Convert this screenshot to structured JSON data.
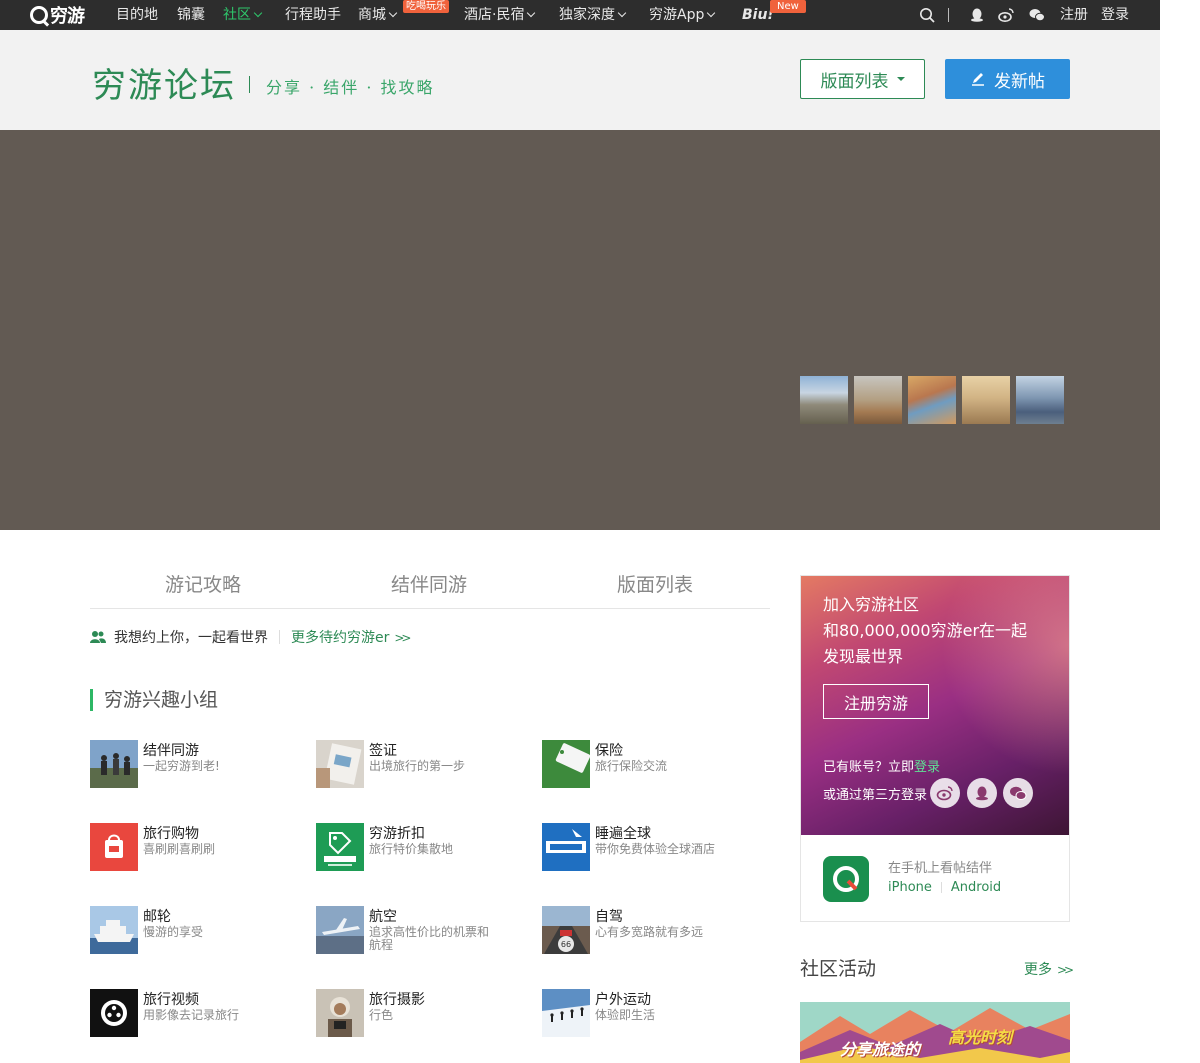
{
  "nav": {
    "logo": "穷游",
    "items": [
      {
        "label": "目的地"
      },
      {
        "label": "锦囊"
      },
      {
        "label": "社区"
      },
      {
        "label": "行程助手"
      },
      {
        "label": "商城",
        "badge": "吃喝玩乐"
      },
      {
        "label": "酒店·民宿"
      },
      {
        "label": "独家深度"
      },
      {
        "label": "穷游App"
      },
      {
        "label": "Biu!",
        "badge": "New"
      }
    ],
    "register": "注册",
    "login": "登录"
  },
  "header": {
    "title": "穷游论坛",
    "slogan": "分享 · 结伴 · 找攻略",
    "board_button": "版面列表",
    "post_button": "发新帖"
  },
  "tabs": [
    "游记攻略",
    "结伴同游",
    "版面列表"
  ],
  "invite": {
    "text": "我想约上你，一起看世界",
    "more": "更多待约穷游er"
  },
  "groups": {
    "title": "穷游兴趣小组",
    "items": [
      {
        "name": "结伴同游",
        "desc": "一起穷游到老!"
      },
      {
        "name": "签证",
        "desc": "出境旅行的第一步"
      },
      {
        "name": "保险",
        "desc": "旅行保险交流"
      },
      {
        "name": "旅行购物",
        "desc": "喜刷刷喜刷刷"
      },
      {
        "name": "穷游折扣",
        "desc": "旅行特价集散地"
      },
      {
        "name": "睡遍全球",
        "desc": "带你免费体验全球酒店"
      },
      {
        "name": "邮轮",
        "desc": "慢游的享受"
      },
      {
        "name": "航空",
        "desc": "追求高性价比的机票和航程"
      },
      {
        "name": "自驾",
        "desc": "心有多宽路就有多远"
      },
      {
        "name": "旅行视频",
        "desc": "用影像去记录旅行"
      },
      {
        "name": "旅行摄影",
        "desc": "行色"
      },
      {
        "name": "户外运动",
        "desc": "体验即生活"
      }
    ]
  },
  "join": {
    "line1": "加入穷游社区",
    "line2": "和80,000,000穷游er在一起",
    "line3": "发现最世界",
    "button": "注册穷游",
    "have_account": "已有账号？立即",
    "login": "登录",
    "third_party": "或通过第三方登录"
  },
  "app": {
    "text": "在手机上看帖结伴",
    "iphone": "iPhone",
    "android": "Android"
  },
  "activities": {
    "title": "社区活动",
    "more": "更多",
    "banner_text": "分享旅途的",
    "banner_highlight": "高光时刻"
  },
  "colors": {
    "accent_green": "#2d8a55",
    "blue_button": "#2e8fdb",
    "nav_bg": "#2d2d2d",
    "hero_bg": "#625a53"
  }
}
